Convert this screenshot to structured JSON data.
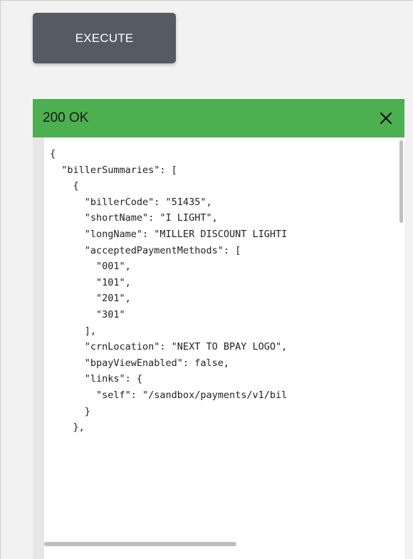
{
  "execute_button": {
    "label": "EXECUTE"
  },
  "response": {
    "status": "200 OK",
    "status_color": "#4caf50",
    "close_icon": "close-icon",
    "json_lines": [
      "{",
      "  \"billerSummaries\": [",
      "    {",
      "      \"billerCode\": \"51435\",",
      "      \"shortName\": \"I LIGHT\",",
      "      \"longName\": \"MILLER DISCOUNT LIGHTI",
      "      \"acceptedPaymentMethods\": [",
      "        \"001\",",
      "        \"101\",",
      "        \"201\",",
      "        \"301\"",
      "      ],",
      "      \"crnLocation\": \"NEXT TO BPAY LOGO\",",
      "      \"bpayViewEnabled\": false,",
      "      \"links\": {",
      "        \"self\": \"/sandbox/payments/v1/bil",
      "      }",
      "    },"
    ]
  }
}
